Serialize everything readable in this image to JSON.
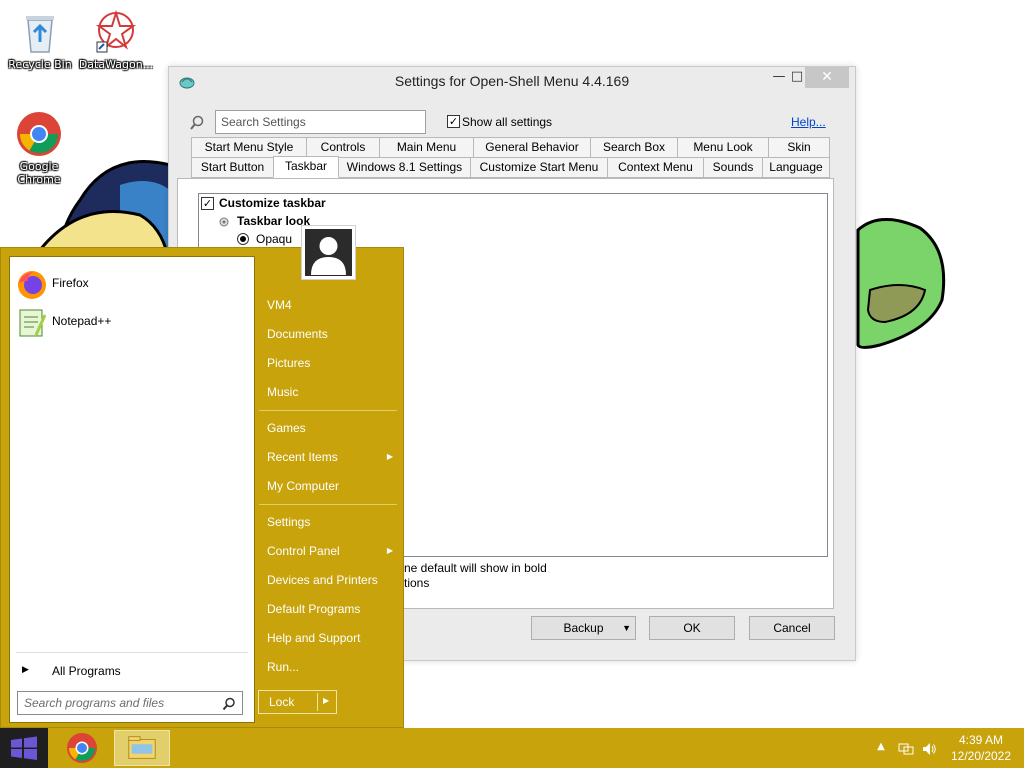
{
  "desktop": {
    "icons": [
      {
        "label": "Recycle Bin"
      },
      {
        "label": "DataWagon..."
      },
      {
        "label": "Google Chrome"
      }
    ]
  },
  "window": {
    "title": "Settings for Open-Shell Menu 4.4.169",
    "search_placeholder": "Search Settings",
    "show_all_label": "Show all settings",
    "show_all_checked": true,
    "help_label": "Help...",
    "tabs_row1": [
      "Start Menu Style",
      "Controls",
      "Main Menu",
      "General Behavior",
      "Search Box",
      "Menu Look",
      "Skin"
    ],
    "tabs_row2": [
      "Start Button",
      "Taskbar",
      "Windows 8.1 Settings",
      "Customize Start Menu",
      "Context Menu",
      "Sounds",
      "Language"
    ],
    "active_tab": "Taskbar",
    "tree": {
      "customize_taskbar": "Customize taskbar",
      "taskbar_look": "Taskbar look",
      "opaque": "Opaqu"
    },
    "notes": {
      "bold_note": "ne default will show in bold",
      "options_note": "tions"
    },
    "buttons": {
      "backup": "Backup",
      "ok": "OK",
      "cancel": "Cancel"
    }
  },
  "start_menu": {
    "programs": [
      {
        "label": "Firefox",
        "icon": "firefox-icon"
      },
      {
        "label": "Notepad++",
        "icon": "notepadpp-icon"
      }
    ],
    "all_programs": "All Programs",
    "search_placeholder": "Search programs and files",
    "right_items": {
      "vm4": "VM4",
      "documents": "Documents",
      "pictures": "Pictures",
      "music": "Music",
      "games": "Games",
      "recent_items": "Recent Items",
      "my_computer": "My Computer",
      "settings": "Settings",
      "control_panel": "Control Panel",
      "devices_printers": "Devices and Printers",
      "default_programs": "Default Programs",
      "help_support": "Help and Support",
      "run": "Run..."
    },
    "lock_label": "Lock"
  },
  "taskbar": {
    "time": "4:39 AM",
    "date": "12/20/2022",
    "accent_color": "#c8a30c"
  }
}
